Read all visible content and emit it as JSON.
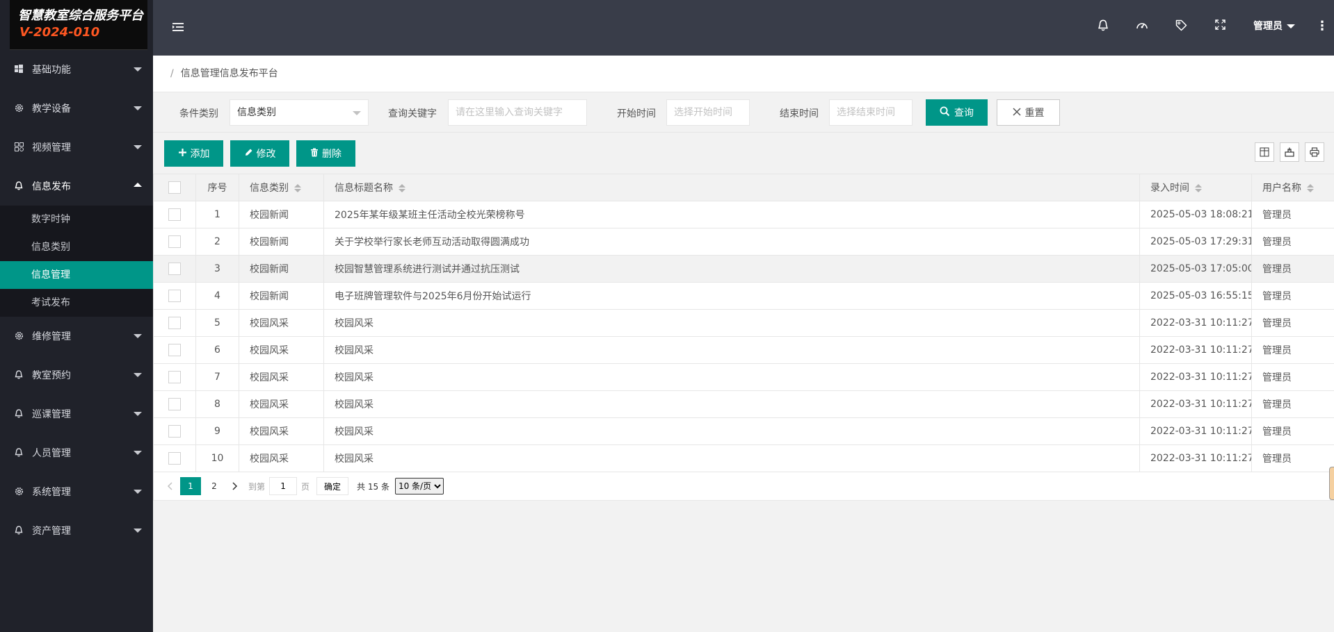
{
  "app": {
    "title_line1": "智慧教室综合服务平台",
    "title_line2": "V-2024-010"
  },
  "sidebar": {
    "items": [
      {
        "label": "基础功能",
        "icon": "windows-icon"
      },
      {
        "label": "教学设备",
        "icon": "gear-icon"
      },
      {
        "label": "视频管理",
        "icon": "apps-icon"
      },
      {
        "label": "信息发布",
        "icon": "bell-icon",
        "open": true
      },
      {
        "label": "维修管理",
        "icon": "gear-icon"
      },
      {
        "label": "教室预约",
        "icon": "bell-icon"
      },
      {
        "label": "巡课管理",
        "icon": "bell-icon"
      },
      {
        "label": "人员管理",
        "icon": "bell-icon"
      },
      {
        "label": "系统管理",
        "icon": "gear-icon"
      },
      {
        "label": "资产管理",
        "icon": "bell-icon"
      }
    ],
    "submenu": [
      {
        "label": "数字时钟"
      },
      {
        "label": "信息类别"
      },
      {
        "label": "信息管理",
        "active": true
      },
      {
        "label": "考试发布"
      }
    ]
  },
  "header": {
    "user": "管理员",
    "icons": [
      "bell-icon",
      "dashboard-icon",
      "tag-icon",
      "fullscreen-icon"
    ]
  },
  "breadcrumb": {
    "separator": "/",
    "current": "信息管理信息发布平台"
  },
  "search": {
    "category_label": "条件类别",
    "category_value": "信息类别",
    "keyword_label": "查询关键字",
    "keyword_placeholder": "请在这里输入查询关键字",
    "start_label": "开始时间",
    "start_placeholder": "选择开始时间",
    "end_label": "结束时间",
    "end_placeholder": "选择结束时间",
    "query_label": "查询",
    "reset_label": "重置"
  },
  "toolbar": {
    "add_label": "添加",
    "edit_label": "修改",
    "delete_label": "删除"
  },
  "table": {
    "columns": [
      "序号",
      "信息类别",
      "信息标题名称",
      "录入时间",
      "用户名称"
    ],
    "rows": [
      {
        "no": "1",
        "category": "校园新闻",
        "title": "2025年某年级某班主任活动全校光荣榜称号",
        "time": "2025-05-03 18:08:21",
        "user": "管理员"
      },
      {
        "no": "2",
        "category": "校园新闻",
        "title": "关于学校举行家长老师互动活动取得圆满成功",
        "time": "2025-05-03 17:29:31",
        "user": "管理员"
      },
      {
        "no": "3",
        "category": "校园新闻",
        "title": "校园智慧管理系统进行测试并通过抗压测试",
        "time": "2025-05-03 17:05:00",
        "user": "管理员"
      },
      {
        "no": "4",
        "category": "校园新闻",
        "title": "电子班牌管理软件与2025年6月份开始试运行",
        "time": "2025-05-03 16:55:15",
        "user": "管理员"
      },
      {
        "no": "5",
        "category": "校园风采",
        "title": "校园风采",
        "time": "2022-03-31 10:11:27",
        "user": "管理员"
      },
      {
        "no": "6",
        "category": "校园风采",
        "title": "校园风采",
        "time": "2022-03-31 10:11:27",
        "user": "管理员"
      },
      {
        "no": "7",
        "category": "校园风采",
        "title": "校园风采",
        "time": "2022-03-31 10:11:27",
        "user": "管理员"
      },
      {
        "no": "8",
        "category": "校园风采",
        "title": "校园风采",
        "time": "2022-03-31 10:11:27",
        "user": "管理员"
      },
      {
        "no": "9",
        "category": "校园风采",
        "title": "校园风采",
        "time": "2022-03-31 10:11:27",
        "user": "管理员"
      },
      {
        "no": "10",
        "category": "校园风采",
        "title": "校园风采",
        "time": "2022-03-31 10:11:27",
        "user": "管理员"
      }
    ]
  },
  "pagination": {
    "pages": [
      "1",
      "2"
    ],
    "current_page": "1",
    "goto_label": "到第",
    "goto_value": "1",
    "page_unit": "页",
    "confirm_label": "确定",
    "total_text": "共 15 条",
    "page_size": "10 条/页"
  },
  "colors": {
    "accent": "#009688",
    "sidebar_bg": "#20222a",
    "header_bg": "#393d49",
    "logo_version": "#ff5722"
  }
}
